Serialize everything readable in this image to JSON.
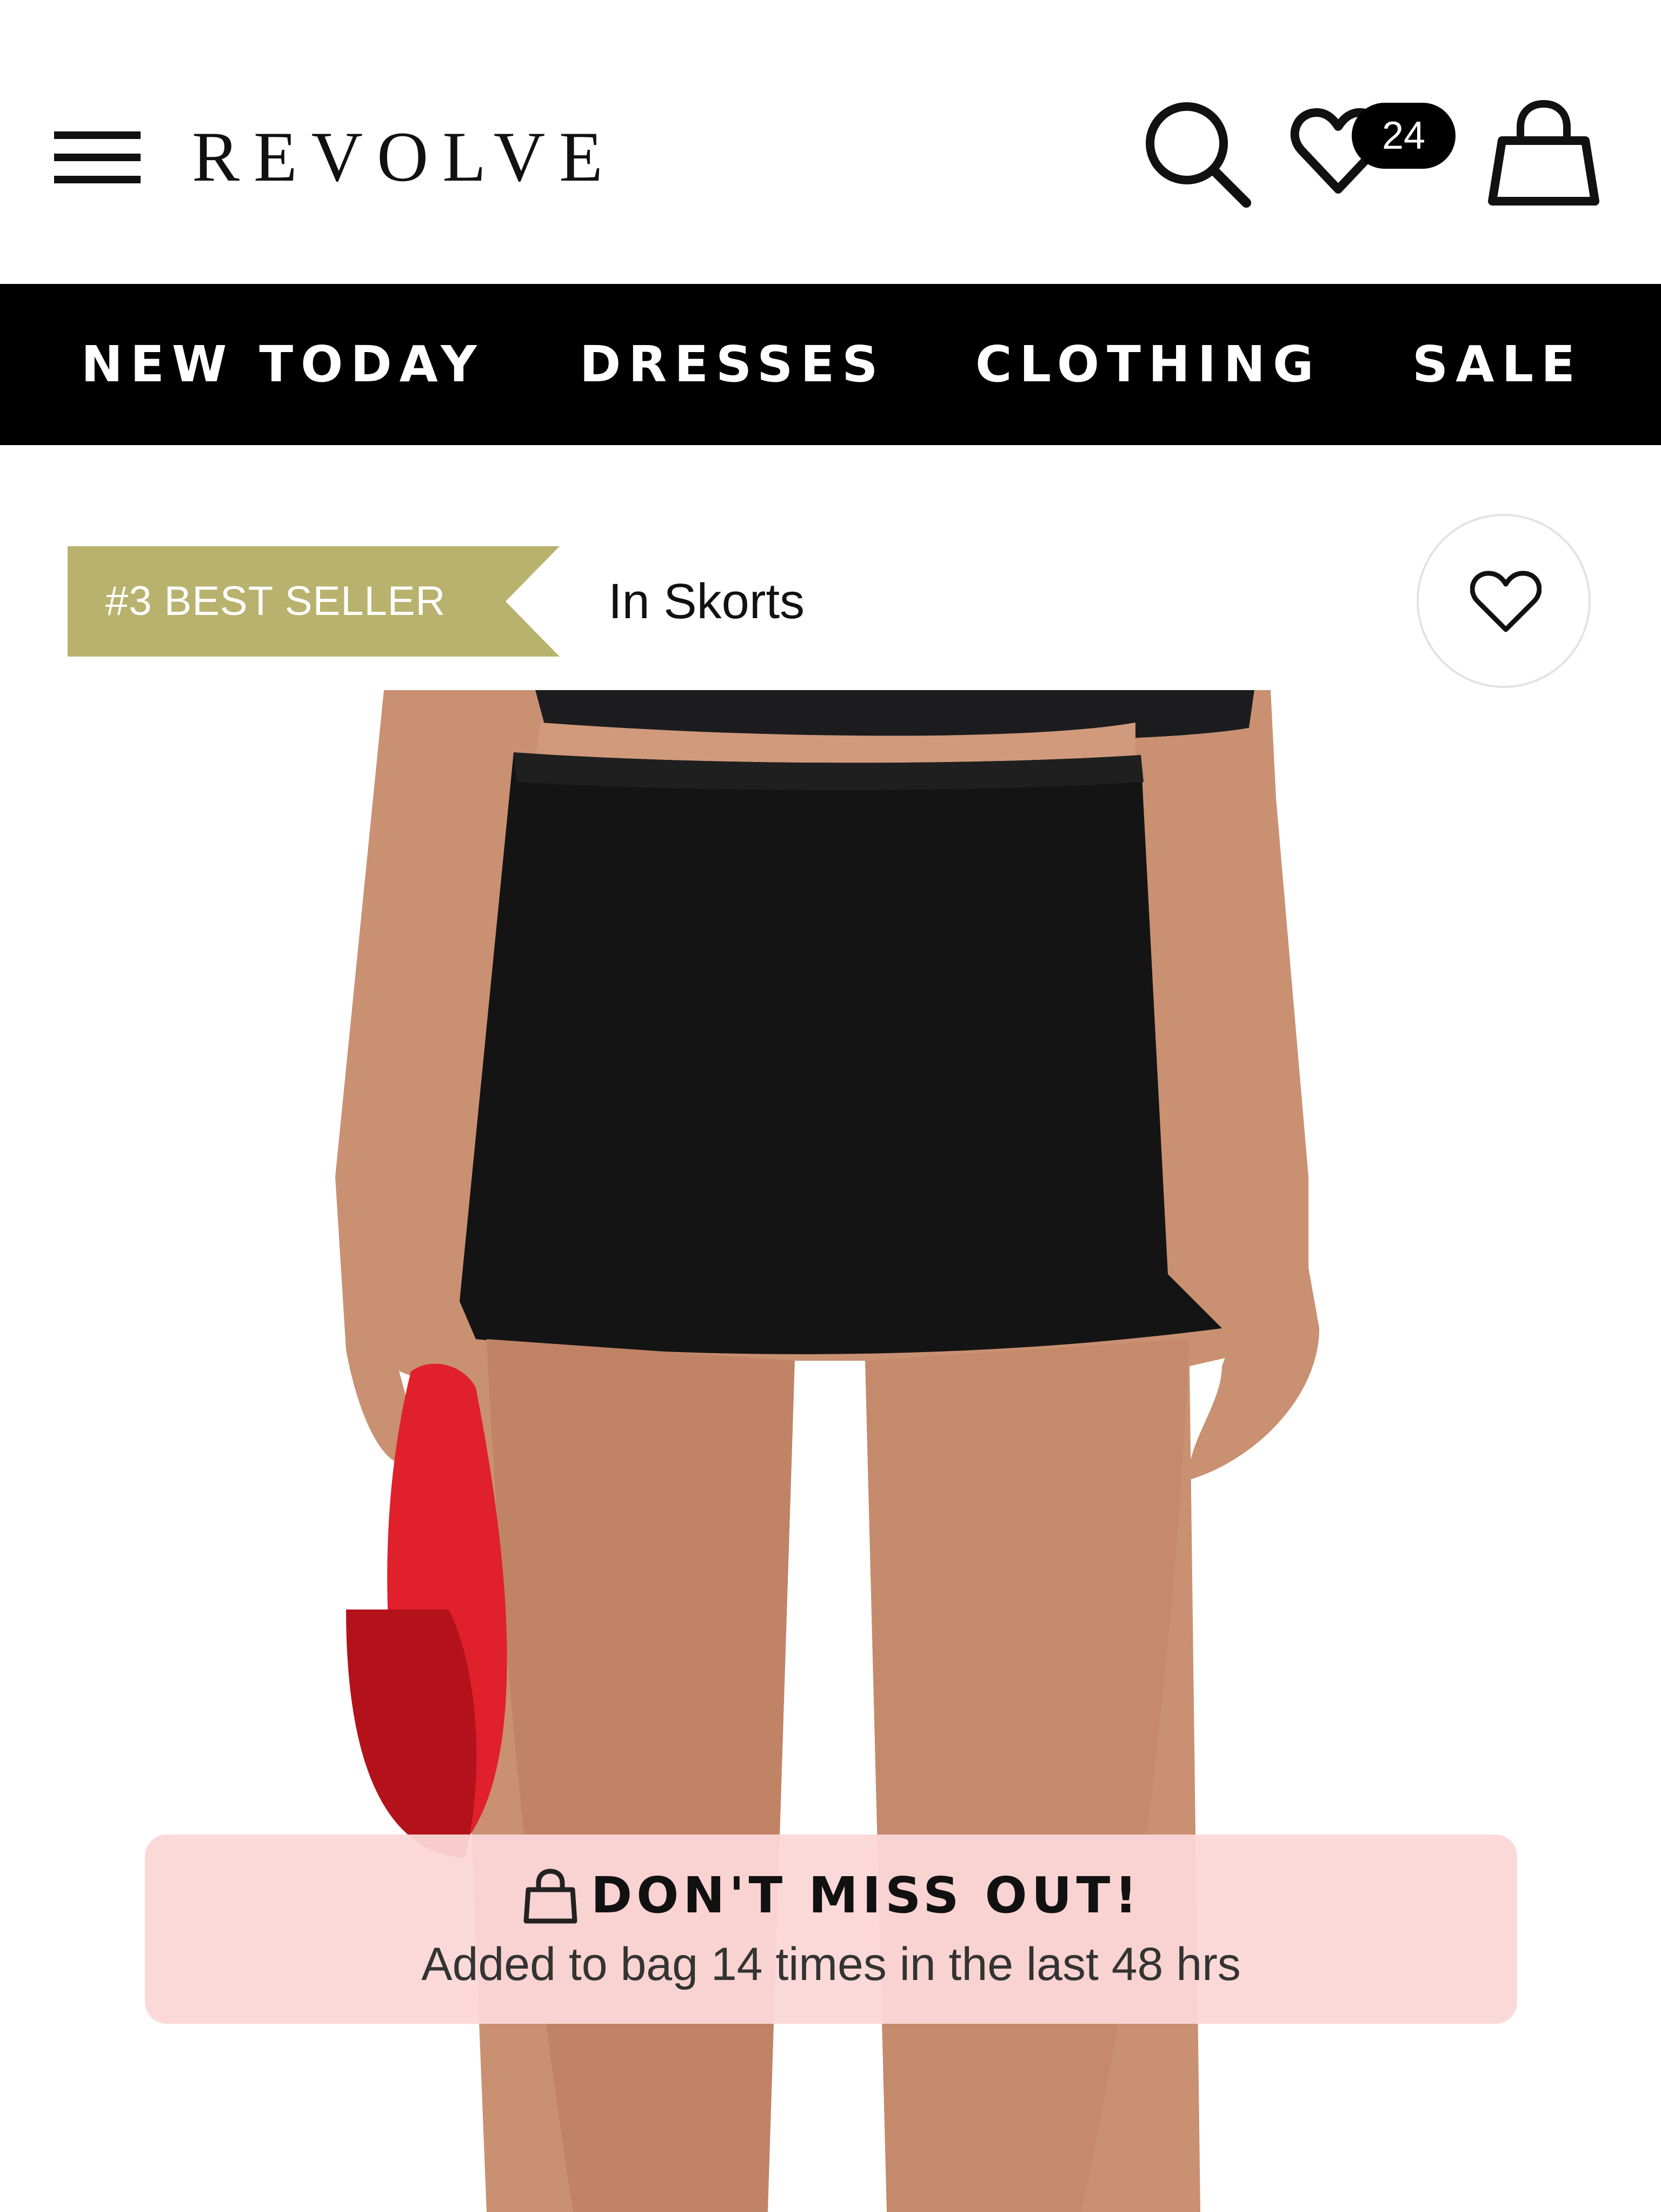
{
  "header": {
    "logo": "REVOLVE",
    "wishlist_count": "24"
  },
  "nav": {
    "items": [
      {
        "label": "NEW TODAY"
      },
      {
        "label": "DRESSES"
      },
      {
        "label": "CLOTHING"
      },
      {
        "label": "SALE"
      }
    ]
  },
  "product": {
    "rank_badge": "#3 BEST SELLER",
    "rank_category": "In Skorts",
    "badge_color": "#b8b26e"
  },
  "alert": {
    "title": "DON'T MISS OUT!",
    "subtitle": "Added to bag 14 times in the last 48 hrs",
    "background": "#fcd7d7"
  },
  "icons": {
    "menu": "hamburger-menu-icon",
    "search": "search-icon",
    "wishlist": "heart-icon",
    "bag": "shopping-bag-icon",
    "favorite": "heart-outline-icon",
    "alert": "shopping-bag-icon"
  }
}
